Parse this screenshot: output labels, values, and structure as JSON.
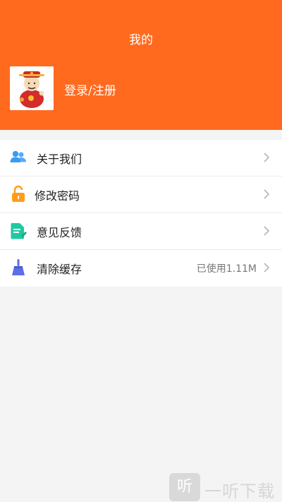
{
  "header": {
    "title": "我的",
    "login_label": "登录/注册"
  },
  "menu": [
    {
      "label": "关于我们",
      "icon": "users-icon",
      "value": ""
    },
    {
      "label": "修改密码",
      "icon": "unlock-icon",
      "value": ""
    },
    {
      "label": "意见反馈",
      "icon": "feedback-doc-icon",
      "value": ""
    },
    {
      "label": "清除缓存",
      "icon": "broom-icon",
      "value": "已使用1.11M"
    }
  ],
  "watermark": {
    "logo_char": "听",
    "text": "一听下载"
  },
  "colors": {
    "accent": "#ff6a1f",
    "users_icon": "#3a9bf5",
    "unlock_icon": "#ff9d1a",
    "feedback_icon": "#1fc8a0",
    "broom_icon": "#5a6ee8"
  }
}
